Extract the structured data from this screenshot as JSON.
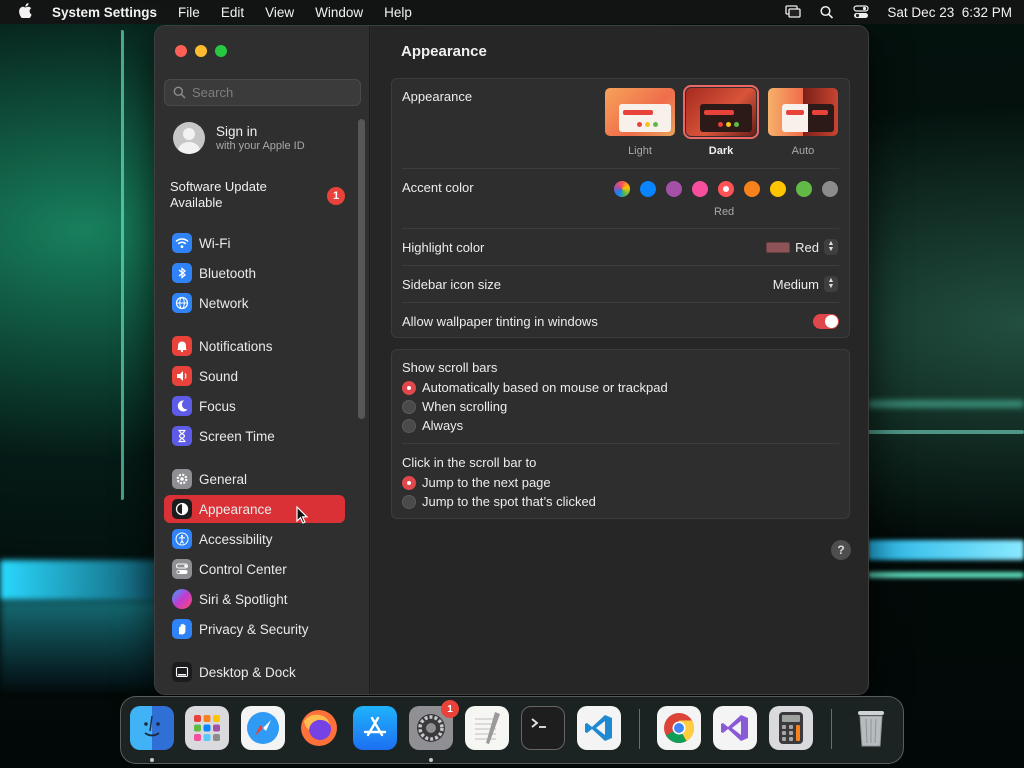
{
  "menubar": {
    "app_name": "System Settings",
    "items": [
      "File",
      "Edit",
      "View",
      "Window",
      "Help"
    ],
    "datetime": "Sat Dec 23  6:32 PM"
  },
  "sidebar": {
    "search_placeholder": "Search",
    "signin": {
      "title": "Sign in",
      "subtitle": "with your Apple ID"
    },
    "software_update": {
      "label": "Software Update Available",
      "badge": "1"
    },
    "items": [
      {
        "label": "Wi-Fi",
        "icon": "wifi-icon",
        "color": "#2f83f6"
      },
      {
        "label": "Bluetooth",
        "icon": "bluetooth-icon",
        "color": "#2f83f6"
      },
      {
        "label": "Network",
        "icon": "globe-icon",
        "color": "#2f83f6"
      },
      {
        "label": "Notifications",
        "icon": "bell-icon",
        "color": "#e9423a"
      },
      {
        "label": "Sound",
        "icon": "speaker-icon",
        "color": "#e9423a"
      },
      {
        "label": "Focus",
        "icon": "moon-icon",
        "color": "#5e5ce6"
      },
      {
        "label": "Screen Time",
        "icon": "hourglass-icon",
        "color": "#5e5ce6"
      },
      {
        "label": "General",
        "icon": "gear-icon",
        "color": "#8e8e93"
      },
      {
        "label": "Appearance",
        "icon": "appearance-icon",
        "color": "#1c1c1e",
        "selected": true
      },
      {
        "label": "Accessibility",
        "icon": "accessibility-icon",
        "color": "#2f83f6"
      },
      {
        "label": "Control Center",
        "icon": "control-center-icon",
        "color": "#8e8e93"
      },
      {
        "label": "Siri & Spotlight",
        "icon": "siri-icon",
        "color": "#8e44ad"
      },
      {
        "label": "Privacy & Security",
        "icon": "hand-icon",
        "color": "#2f83f6"
      },
      {
        "label": "Desktop & Dock",
        "icon": "dock-icon",
        "color": "#1c1c1e"
      }
    ]
  },
  "main": {
    "title": "Appearance",
    "appearance": {
      "label": "Appearance",
      "options": [
        "Light",
        "Dark",
        "Auto"
      ],
      "selected": "Dark"
    },
    "accent": {
      "label": "Accent color",
      "colors": [
        "multicolor",
        "#0a84ff",
        "#a550a7",
        "#f74f9e",
        "#ff5257",
        "#f7821b",
        "#ffc600",
        "#62ba46",
        "#8c8c8c"
      ],
      "selected_name": "Red"
    },
    "highlight": {
      "label": "Highlight color",
      "value": "Red",
      "swatch": "#8c5456"
    },
    "sidebar_icon_size": {
      "label": "Sidebar icon size",
      "value": "Medium"
    },
    "wallpaper_tinting": {
      "label": "Allow wallpaper tinting in windows",
      "on": true
    },
    "scroll_bars": {
      "label": "Show scroll bars",
      "options": [
        "Automatically based on mouse or trackpad",
        "When scrolling",
        "Always"
      ],
      "selected_index": 0
    },
    "click_scroll": {
      "label": "Click in the scroll bar to",
      "options": [
        "Jump to the next page",
        "Jump to the spot that’s clicked"
      ],
      "selected_index": 0
    },
    "help": "?"
  },
  "dock": {
    "apps": [
      "Finder",
      "Launchpad",
      "Safari",
      "Firefox",
      "App Store",
      "System Settings",
      "TextEdit",
      "Terminal",
      "Visual Studio Code",
      "Google Chrome",
      "Visual Studio",
      "Calculator",
      "Trash"
    ],
    "system_settings_badge": "1"
  }
}
